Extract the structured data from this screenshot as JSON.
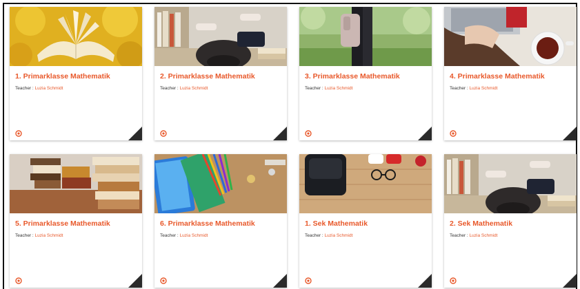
{
  "teacher_label": "Teacher :",
  "cards": [
    {
      "title": "1. Primarklasse Mathematik",
      "teacher": "Luzia Schmidt",
      "image": "open-book-autumn-leaves"
    },
    {
      "title": "2. Primarklasse Mathematik",
      "teacher": "Luzia Schmidt",
      "image": "student-asleep-on-books"
    },
    {
      "title": "3. Primarklasse Mathematik",
      "teacher": "Luzia Schmidt",
      "image": "student-with-backpack-on-grass"
    },
    {
      "title": "4. Primarklasse Mathematik",
      "teacher": "Luzia Schmidt",
      "image": "laptop-and-tea-cup"
    },
    {
      "title": "5. Primarklasse Mathematik",
      "teacher": "Luzia Schmidt",
      "image": "book-stacks-on-table"
    },
    {
      "title": "6. Primarklasse Mathematik",
      "teacher": "Luzia Schmidt",
      "image": "colored-pencils-and-notebooks"
    },
    {
      "title": "1. Sek Mathematik",
      "teacher": "Luzia Schmidt",
      "image": "school-bag-sneakers-glasses"
    },
    {
      "title": "2. Sek Mathematik",
      "teacher": "Luzia Schmidt",
      "image": "student-asleep-on-books"
    }
  ],
  "colors": {
    "accent": "#e8582a",
    "corner": "#2b2b2b"
  }
}
